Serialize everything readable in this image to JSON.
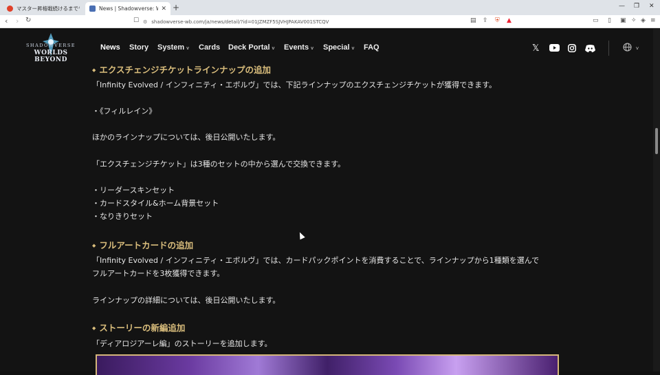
{
  "browser": {
    "tabs": [
      {
        "title": "マスター昇格戦続けるまでやる | OPENREC"
      },
      {
        "title": "News | Shadowverse: Worlds Be"
      }
    ],
    "new_tab": "+",
    "url": "shadowverse-wb.com/ja/news/detail/?id=01JZMZF5SJVHJPAKAV001STCQV",
    "window_controls": {
      "minimize": "—",
      "restore": "❐",
      "close": "✕"
    }
  },
  "site": {
    "logo": {
      "line1": "SHADOWVERSE",
      "line2": "WORLDS BEYOND"
    },
    "nav": [
      {
        "label": "News"
      },
      {
        "label": "Story"
      },
      {
        "label": "System",
        "dropdown": "v"
      },
      {
        "label": "Cards"
      },
      {
        "label": "Deck Portal",
        "dropdown": "v"
      },
      {
        "label": "Events",
        "dropdown": "v"
      },
      {
        "label": "Special",
        "dropdown": "v"
      },
      {
        "label": "FAQ"
      }
    ],
    "social_icons": [
      "x-icon",
      "youtube-icon",
      "instagram-icon",
      "discord-icon"
    ],
    "language_caret": "v"
  },
  "article": {
    "sections": [
      {
        "heading": "エクスチェンジチケットラインナップの追加",
        "paragraphs": [
          "「Infinity Evolved / インフィニティ・エボルヴ」では、下記ラインナップのエクスチェンジチケットが獲得できます。",
          "・《フィルレイン》",
          "ほかのラインナップについては、後日公開いたします。",
          "「エクスチェンジチケット」は3種のセットの中から選んで交換できます。",
          "・リーダースキンセット",
          "・カードスタイル&ホーム背景セット",
          "・なりきりセット"
        ]
      },
      {
        "heading": "フルアートカードの追加",
        "paragraphs": [
          "「Infinity Evolved / インフィニティ・エボルヴ」では、カードパックポイントを消費することで、ラインナップから1種類を選んで",
          "フルアートカードを3枚獲得できます。",
          "ラインナップの詳細については、後日公開いたします。"
        ]
      },
      {
        "heading": "ストーリーの新編追加",
        "paragraphs": [
          "「ディアロジアーレ編」のストーリーを追加します。"
        ]
      }
    ]
  },
  "colors": {
    "background": "#131313",
    "heading_gold": "#d9bd7c",
    "body_text": "#e6e6e6"
  }
}
